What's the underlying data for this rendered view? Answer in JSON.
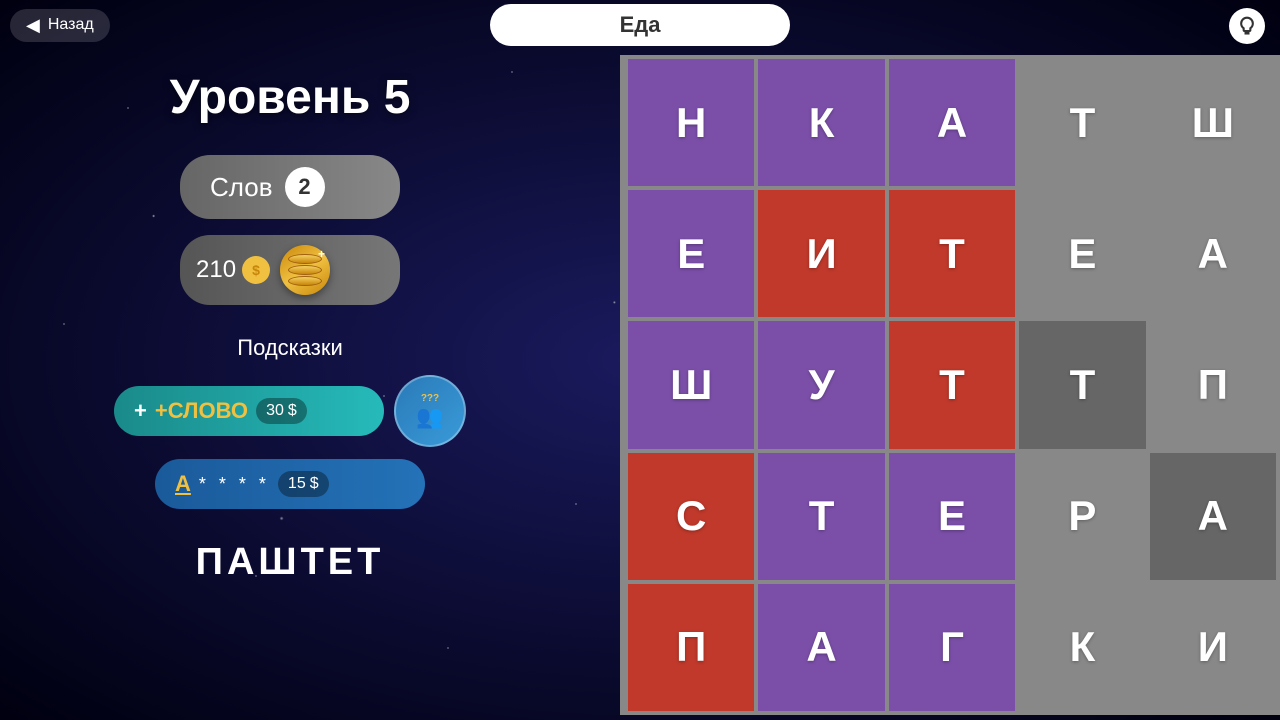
{
  "topbar": {
    "back_label": "Назад",
    "topic": "Еда"
  },
  "left": {
    "level_title": "Уровень 5",
    "words_label": "Слов",
    "words_count": "2",
    "coins_amount": "210",
    "coin_symbol": "$",
    "hints_label": "Подсказки",
    "hint_word_btn": "+СЛОВО",
    "hint_word_cost": "30",
    "hint_word_cost_symbol": "$",
    "hint_letter_a": "А",
    "hint_letter_stars": "* * * *",
    "hint_letter_cost": "15",
    "hint_letter_cost_symbol": "$",
    "social_hint_questions": "???",
    "current_word": "ПАШТЕТ"
  },
  "grid": {
    "cells": [
      {
        "letter": "Н",
        "color": "purple"
      },
      {
        "letter": "К",
        "color": "purple"
      },
      {
        "letter": "А",
        "color": "purple"
      },
      {
        "letter": "Т",
        "color": "gray"
      },
      {
        "letter": "Ш",
        "color": "gray"
      },
      {
        "letter": "Е",
        "color": "purple"
      },
      {
        "letter": "И",
        "color": "red"
      },
      {
        "letter": "Т",
        "color": "red"
      },
      {
        "letter": "Е",
        "color": "gray"
      },
      {
        "letter": "А",
        "color": "gray"
      },
      {
        "letter": "Ш",
        "color": "purple"
      },
      {
        "letter": "У",
        "color": "purple"
      },
      {
        "letter": "Т",
        "color": "red"
      },
      {
        "letter": "Т",
        "color": "dark-gray"
      },
      {
        "letter": "П",
        "color": "gray"
      },
      {
        "letter": "С",
        "color": "red"
      },
      {
        "letter": "Т",
        "color": "purple"
      },
      {
        "letter": "Е",
        "color": "purple"
      },
      {
        "letter": "Р",
        "color": "gray"
      },
      {
        "letter": "А",
        "color": "dark-gray"
      },
      {
        "letter": "П",
        "color": "red"
      },
      {
        "letter": "А",
        "color": "purple"
      },
      {
        "letter": "Г",
        "color": "purple"
      },
      {
        "letter": "К",
        "color": "gray"
      },
      {
        "letter": "И",
        "color": "gray"
      }
    ]
  }
}
